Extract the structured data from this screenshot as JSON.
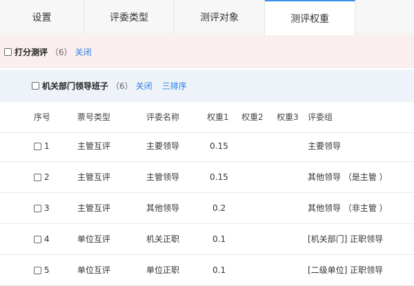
{
  "tabs": [
    {
      "label": "设置"
    },
    {
      "label": "评委类型"
    },
    {
      "label": "测评对象"
    },
    {
      "label": "测评权重"
    }
  ],
  "section1": {
    "title": "打分测评",
    "count": "（6）",
    "toggle": "关闭"
  },
  "section2": {
    "title": "机关部门领导班子",
    "count": "（6）",
    "toggle": "关闭",
    "sort": "三排序"
  },
  "table": {
    "headers": {
      "seq": "序号",
      "type": "票号类型",
      "name": "评委名称",
      "w1": "权重1",
      "w2": "权重2",
      "w3": "权重3",
      "group": "评委组"
    },
    "rows": [
      {
        "seq": "1",
        "type": "主管互评",
        "name": "主要领导",
        "w1": "0.15",
        "group": "主要领导"
      },
      {
        "seq": "2",
        "type": "主管互评",
        "name": "主管领导",
        "w1": "0.15",
        "group": "其他领导 （是主管 ）"
      },
      {
        "seq": "3",
        "type": "主管互评",
        "name": "其他领导",
        "w1": "0.2",
        "group": "其他领导 （非主管 ）"
      },
      {
        "seq": "4",
        "type": "单位互评",
        "name": "机关正职",
        "w1": "0.1",
        "group": "[机关部门] 正职领导"
      },
      {
        "seq": "5",
        "type": "单位互评",
        "name": "单位正职",
        "w1": "0.1",
        "group": "[二级单位] 正职领导"
      }
    ]
  }
}
